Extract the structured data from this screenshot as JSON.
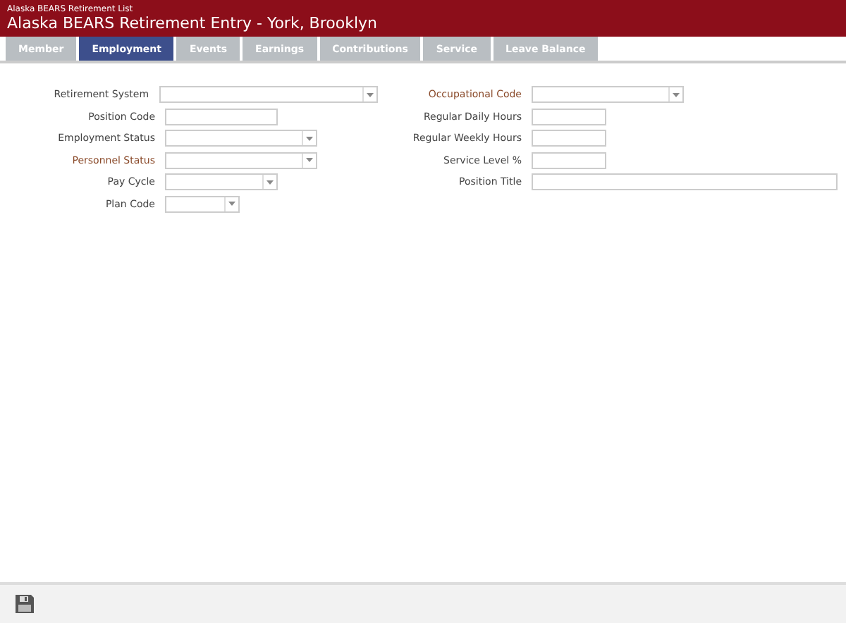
{
  "window": {
    "subtitle": "Alaska BEARS Retirement List",
    "title": "Alaska BEARS Retirement Entry - York, Brooklyn"
  },
  "tabs": [
    {
      "label": "Member",
      "selected": false
    },
    {
      "label": "Employment",
      "selected": true
    },
    {
      "label": "Events",
      "selected": false
    },
    {
      "label": "Earnings",
      "selected": false
    },
    {
      "label": "Contributions",
      "selected": false
    },
    {
      "label": "Service",
      "selected": false
    },
    {
      "label": "Leave Balance",
      "selected": false
    }
  ],
  "left_fields": [
    {
      "label": "Retirement System",
      "kind": "select",
      "required": false
    },
    {
      "label": "Position Code",
      "kind": "text",
      "required": false
    },
    {
      "label": "Employment Status",
      "kind": "select",
      "required": false
    },
    {
      "label": "Personnel Status",
      "kind": "select",
      "required": true
    },
    {
      "label": "Pay Cycle",
      "kind": "select",
      "required": false
    },
    {
      "label": "Plan Code",
      "kind": "select",
      "required": false
    }
  ],
  "right_fields": [
    {
      "label": "Occupational Code",
      "kind": "select",
      "required": true
    },
    {
      "label": "Regular Daily Hours",
      "kind": "text",
      "required": false
    },
    {
      "label": "Regular Weekly Hours",
      "kind": "text",
      "required": false
    },
    {
      "label": "Service Level %",
      "kind": "text",
      "required": false
    },
    {
      "label": "Position Title",
      "kind": "text",
      "required": false
    }
  ]
}
